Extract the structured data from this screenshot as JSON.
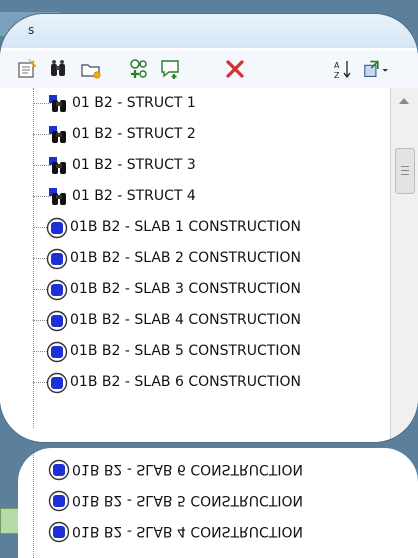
{
  "panel": {
    "title": "s"
  },
  "toolbar": {
    "buttons": [
      {
        "name": "new-set-icon"
      },
      {
        "name": "find-icon"
      },
      {
        "name": "new-folder-icon"
      },
      {
        "name": "group-icon"
      },
      {
        "name": "comment-icon"
      },
      {
        "name": "delete-icon"
      },
      {
        "name": "sort-az-icon"
      },
      {
        "name": "import-export-icon"
      }
    ]
  },
  "tree": {
    "items": [
      {
        "label": "01 B2 - STRUCT 1",
        "icon": "search-set-icon"
      },
      {
        "label": "01 B2 - STRUCT 2",
        "icon": "search-set-icon"
      },
      {
        "label": "01 B2 - STRUCT 3",
        "icon": "search-set-icon"
      },
      {
        "label": "01 B2 - STRUCT 4",
        "icon": "search-set-icon"
      },
      {
        "label": "01B B2 - SLAB 1 CONSTRUCTION",
        "icon": "selection-set-icon"
      },
      {
        "label": "01B B2 - SLAB 2 CONSTRUCTION",
        "icon": "selection-set-icon"
      },
      {
        "label": "01B B2 - SLAB 3 CONSTRUCTION",
        "icon": "selection-set-icon"
      },
      {
        "label": "01B B2 - SLAB 4 CONSTRUCTION",
        "icon": "selection-set-icon"
      },
      {
        "label": "01B B2 - SLAB 5 CONSTRUCTION",
        "icon": "selection-set-icon"
      },
      {
        "label": "01B B2 - SLAB 6 CONSTRUCTION",
        "icon": "selection-set-icon"
      }
    ]
  },
  "reflection": {
    "items": [
      {
        "label": "01B B2 - SLAB 6 CONSTRUCTION"
      },
      {
        "label": "01B B2 - SLAB 5 CONSTRUCTION"
      },
      {
        "label": "01B B2 - SLAB 4 CONSTRUCTION"
      }
    ]
  },
  "colors": {
    "background": "#5c7f9c",
    "selection_blue": "#1f2fd6",
    "delete_red": "#d33030"
  }
}
